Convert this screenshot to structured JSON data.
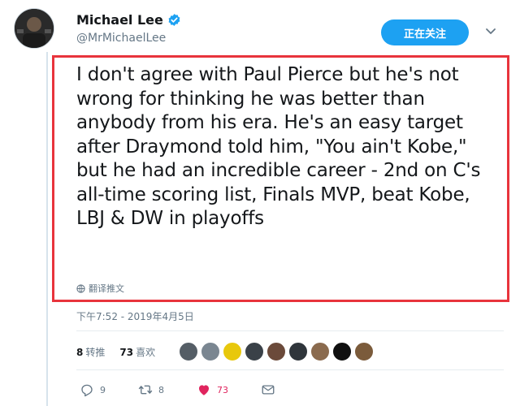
{
  "author": {
    "name": "Michael Lee",
    "handle": "@MrMichaelLee",
    "verified": true
  },
  "follow_button": {
    "label": "正在关注"
  },
  "tweet": {
    "text": "I don't agree with Paul Pierce but he's not wrong for thinking he was better than anybody from his era. He's an easy target after Draymond told him, \"You ain't Kobe,\" but he had an incredible career - 2nd on C's all-time scoring list, Finals MVP, beat Kobe, LBJ & DW in playoffs",
    "translate_label": "翻译推文",
    "timestamp": "下午7:52 - 2019年4月5日"
  },
  "stats": {
    "retweets_count": "8",
    "retweets_label": "转推",
    "likes_count": "73",
    "likes_label": "喜欢"
  },
  "likers": [
    {
      "color": "#555e66"
    },
    {
      "color": "#7a8691"
    },
    {
      "color": "#e8c80c"
    },
    {
      "color": "#3a4148"
    },
    {
      "color": "#6b4a3a"
    },
    {
      "color": "#2f353b"
    },
    {
      "color": "#8a6a4e"
    },
    {
      "color": "#101010"
    },
    {
      "color": "#7b5b3b"
    }
  ],
  "actions": {
    "replies": "9",
    "retweets": "8",
    "likes": "73"
  },
  "colors": {
    "accent": "#1da1f2",
    "like": "#e0245e",
    "highlight_border": "#e8343c"
  }
}
